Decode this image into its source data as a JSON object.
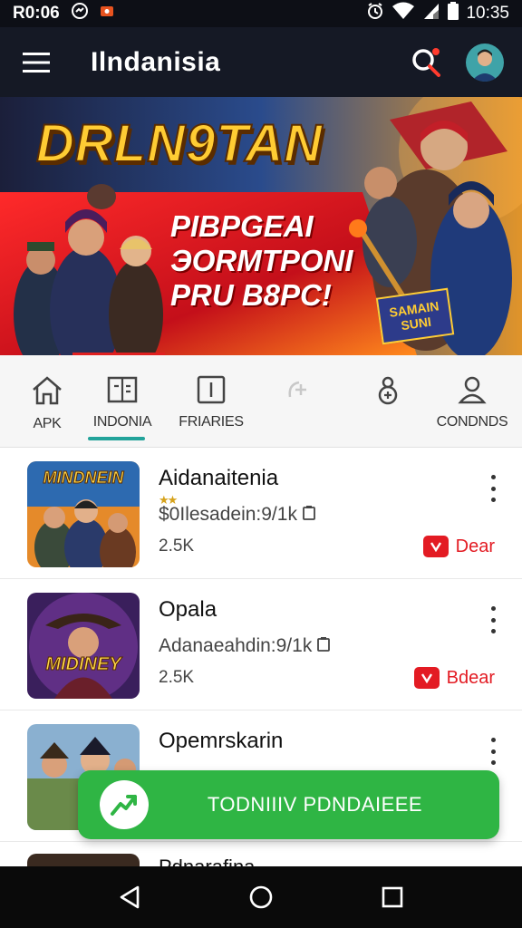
{
  "status_bar": {
    "time_left": "R0:06",
    "time_right": "10:35",
    "icons": [
      "messenger-icon",
      "notification-icon",
      "alarm-icon",
      "wifi-icon",
      "signal-icon",
      "battery-icon"
    ]
  },
  "app_bar": {
    "title": "Ilndanisia",
    "icons": [
      "menu-icon",
      "search-icon",
      "avatar"
    ]
  },
  "banner": {
    "title": "DRLN9TAN",
    "subtitle_lines": [
      "PIBPGEAI",
      "ЭORMTPONI",
      "PRU B8PC!"
    ],
    "sign_text": "SAMAIN\nSUNI"
  },
  "tabs": [
    {
      "label": "APK",
      "icon": "home-icon"
    },
    {
      "label": "INDONIA",
      "icon": "book-icon",
      "selected": true
    },
    {
      "label": "FRIARIES",
      "icon": "square-icon"
    },
    {
      "label": "",
      "icon": "swirl-icon"
    },
    {
      "label": "",
      "icon": "user-plus-icon"
    },
    {
      "label": "CONDNDS",
      "icon": "person-icon"
    }
  ],
  "items": [
    {
      "title": "Aidanaitenia",
      "thumb_text": "MINDNEIN",
      "stars": "★★",
      "subtitle": "$0Ilesadein:9/1k",
      "count": "2.5K",
      "action": "Dear",
      "action_icon": "youtube-icon"
    },
    {
      "title": "Opala",
      "thumb_text": "MIDINEY",
      "stars": "",
      "subtitle": "Adanaeahdin:9/1k",
      "count": "2.5K",
      "action": "Bdear",
      "action_icon": "youtube-icon"
    },
    {
      "title": "Opemrskarin",
      "thumb_text": "",
      "stars": "",
      "subtitle": "",
      "count": "",
      "action": "",
      "action_icon": ""
    }
  ],
  "peek_item": {
    "title": "Pdnarafina"
  },
  "snackbar": {
    "text": "TODNIIIV PDNDAIEEE",
    "icon": "trend-up-icon"
  },
  "nav_bar": {
    "icons": [
      "back-icon",
      "home-circle-icon",
      "recents-icon"
    ]
  },
  "colors": {
    "appbar": "#151925",
    "accent_tab": "#22a39a",
    "action_red": "#e31b23",
    "snackbar_green": "#2fb544",
    "banner_gold": "#ffcc33"
  }
}
